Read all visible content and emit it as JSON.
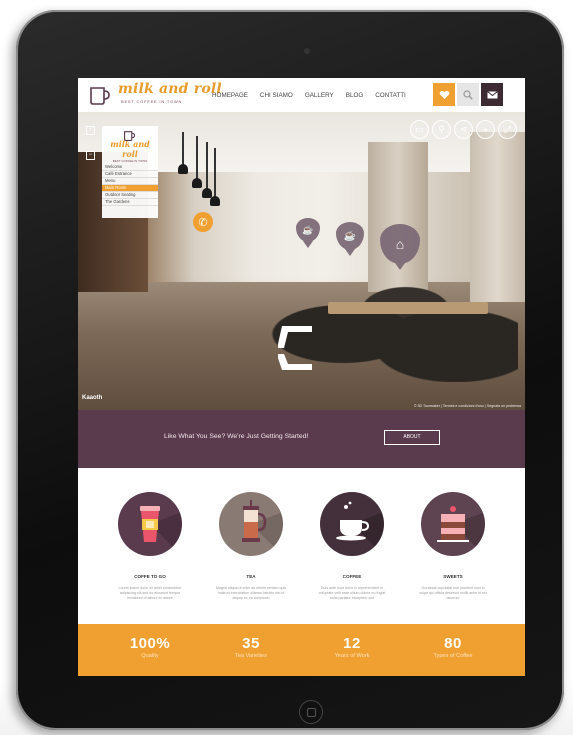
{
  "nav": {
    "logo_text": "milk and roll",
    "logo_tagline": "BEST COFFEE IN TOWN",
    "menu": [
      "HOMEPAGE",
      "CHI SIAMO",
      "GALLERY",
      "BLOG",
      "CONTATTI"
    ],
    "icons": [
      "heart-icon",
      "search-icon",
      "mail-icon"
    ],
    "accent": "#f0a030"
  },
  "tour": {
    "panel_logo": "milk and roll",
    "panel_tagline": "BEST COFFEE IN TOWN",
    "scenes": [
      "Welcome",
      "Café Entrance",
      "Menu",
      "Main Room",
      "Outdoor Seating",
      "The Gardens"
    ],
    "selected_scene": "Main Room",
    "watermark": "Kaaoth",
    "credit": "© 3D Tourmaker  |  Termini e condizioni d'uso  |  Segnala un problema"
  },
  "banner": {
    "text": "Like What You See? We're Just Getting Started!",
    "button": "ABOUT",
    "color": "#5a3a4d"
  },
  "features": [
    {
      "label": "COFFE TO GO",
      "icon": "coffee-cup-icon",
      "desc": "Lorem ipsum dolor sit amet consectetur adipiscing elit sed do eiusmod tempor incididunt ut labore et dolore"
    },
    {
      "label": "TEA",
      "icon": "french-press-icon",
      "desc": "Magna aliqua ut enim ad minim veniam quis nostrud exercitation ullamco laboris nisi ut aliquip ex ea commodo"
    },
    {
      "label": "COFFEE",
      "icon": "coffee-mug-icon",
      "desc": "Duis aute irure dolor in reprehenderit in voluptate velit esse cillum dolore eu fugiat nulla pariatur excepteur sint"
    },
    {
      "label": "SWEETS",
      "icon": "cake-icon",
      "desc": "Occaecat cupidatat non proident sunt in culpa qui officia deserunt mollit anim id est laborum"
    }
  ],
  "stats": [
    {
      "value": "100%",
      "label": "Quality"
    },
    {
      "value": "35",
      "label": "Tea Varieties"
    },
    {
      "value": "12",
      "label": "Years of Work"
    },
    {
      "value": "80",
      "label": "Types of Coffee"
    }
  ]
}
